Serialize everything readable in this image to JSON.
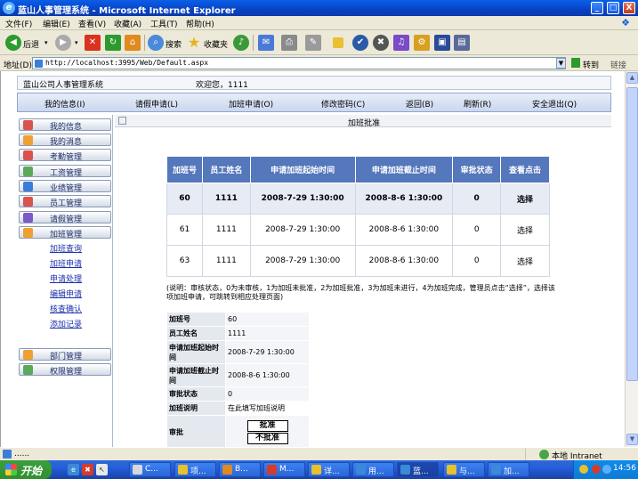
{
  "window": {
    "title": "蓝山人事管理系统 - Microsoft Internet Explorer",
    "min": "_",
    "max": "□",
    "close": "X"
  },
  "menu": [
    "文件(F)",
    "编辑(E)",
    "查看(V)",
    "收藏(A)",
    "工具(T)",
    "帮助(H)"
  ],
  "toolbar": {
    "back": "后退",
    "search": "搜索",
    "favorites": "收藏夹"
  },
  "address": {
    "label": "地址(D)",
    "url": "http://localhost:3995/Web/Default.aspx",
    "go": "转到",
    "links": "链接"
  },
  "app": {
    "system_name": "蓝山公司人事管理系统",
    "welcome": "欢迎您，1111",
    "nav": [
      "我的信息(I)",
      "请假申请(L)",
      "加班申请(O)",
      "修改密码(C)",
      "返回(B)",
      "刷新(R)",
      "安全退出(Q)"
    ]
  },
  "sidebar": {
    "items": [
      {
        "label": "我的信息",
        "color": "#d9534f"
      },
      {
        "label": "我的消息",
        "color": "#f0a030"
      },
      {
        "label": "考勤管理",
        "color": "#d9534f"
      },
      {
        "label": "工资管理",
        "color": "#5ba85b"
      },
      {
        "label": "业绩管理",
        "color": "#3a7dd8"
      },
      {
        "label": "员工管理",
        "color": "#d9534f"
      },
      {
        "label": "请假管理",
        "color": "#7a5ac8"
      },
      {
        "label": "加班管理",
        "color": "#f0a030"
      }
    ],
    "subitems": [
      "加班查询",
      "加班申请",
      "申请处理",
      "编辑申请",
      "核查确认",
      "添加记录"
    ],
    "bottom_items": [
      {
        "label": "部门管理",
        "color": "#f0a030"
      },
      {
        "label": "权限管理",
        "color": "#5ba85b"
      }
    ]
  },
  "main": {
    "title": "加班批准",
    "table": {
      "headers": [
        "加班号",
        "员工姓名",
        "申请加班起始时间",
        "申请加班截止时间",
        "审批状态",
        "查看点击"
      ],
      "rows": [
        [
          "60",
          "1111",
          "2008-7-29 1:30:00",
          "2008-8-6 1:30:00",
          "0",
          "选择"
        ],
        [
          "61",
          "1111",
          "2008-7-29 1:30:00",
          "2008-8-6 1:30:00",
          "0",
          "选择"
        ],
        [
          "63",
          "1111",
          "2008-7-29 1:30:00",
          "2008-8-6 1:30:00",
          "0",
          "选择"
        ]
      ]
    },
    "note": "(说明：审核状态，0为未审核，1为加班未批准，2为加班批准，3为加班未进行，4为加班完成，管理员点击“选择”，选择该项加班申请，可跳转到相应处理页面)",
    "detail": {
      "id_label": "加班号",
      "id": "60",
      "name_label": "员工姓名",
      "name": "1111",
      "start_label": "申请加班起始时间",
      "start": "2008-7-29 1:30:00",
      "end_label": "申请加班截止时间",
      "end": "2008-8-6 1:30:00",
      "status_label": "审批状态",
      "status": "0",
      "desc_label": "加班说明",
      "desc": "在此填写加班说明",
      "approve_label": "审批",
      "approve_btn": "批准",
      "reject_btn": "不批准"
    }
  },
  "status": {
    "text": "......",
    "zone": "本地 Intranet"
  },
  "taskbar": {
    "start": "开始",
    "tasks": [
      "C...",
      "项...",
      "B...",
      "M...",
      "详...",
      "用...",
      "蓝...",
      "与...",
      "加..."
    ],
    "clock": "14:56"
  }
}
